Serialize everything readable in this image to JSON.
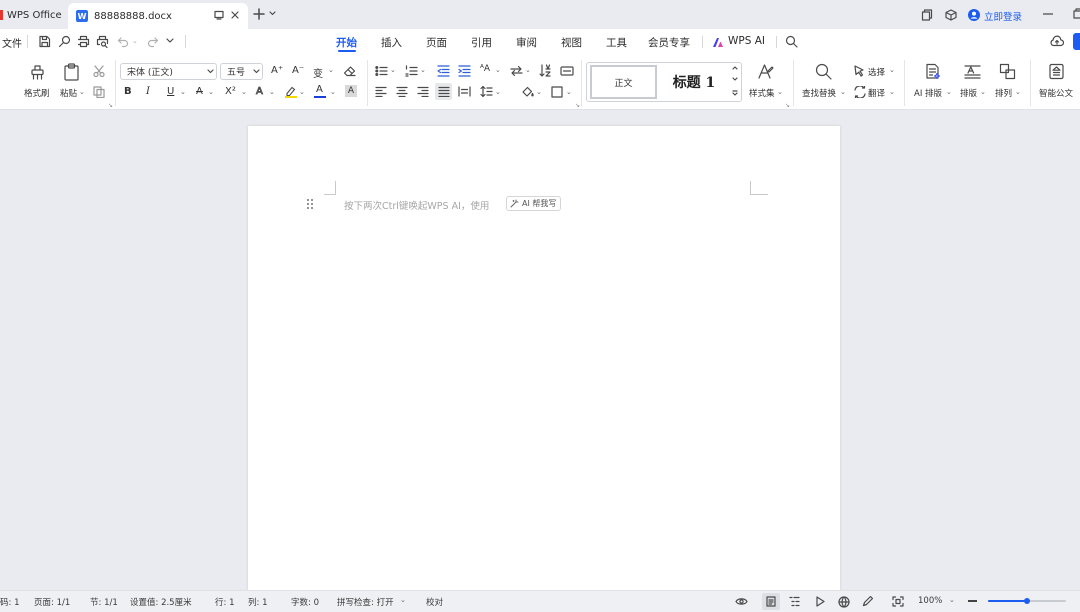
{
  "tabs": {
    "app": "WPS Office",
    "doc": "88888888.docx",
    "doc_icon": "W"
  },
  "window": {
    "login": "立即登录"
  },
  "menu": {
    "file": "文件",
    "items": [
      "开始",
      "插入",
      "页面",
      "引用",
      "审阅",
      "视图",
      "工具",
      "会员专享"
    ],
    "active": "开始",
    "wps_ai": "WPS AI"
  },
  "ribbon": {
    "format_painter": "格式刷",
    "paste": "粘贴",
    "font_name": "宋体 (正文)",
    "font_size": "五号",
    "style_normal": "正文",
    "style_heading": "标题 1",
    "style_set": "样式集",
    "find_replace": "查找替换",
    "select": "选择",
    "translate": "翻译",
    "ai_layout": "AI 排版",
    "layout": "排版",
    "arrange": "排列",
    "smart_doc": "智能公文",
    "bold": "B",
    "italic": "I",
    "underline": "U",
    "strike": "A",
    "superscript": "X²",
    "text_effect": "A",
    "font_color": "A",
    "char_shade": "A",
    "grow_font": "A⁺",
    "shrink_font": "A⁻",
    "pinyin": "变"
  },
  "document": {
    "hint": "按下两次Ctrl键唤起WPS AI，使用",
    "ai_chip": "AI 帮我写"
  },
  "status": {
    "page_no": "码: 1",
    "page": "页面: 1/1",
    "section": "节: 1/1",
    "position": "设置值: 2.5厘米",
    "row": "行: 1",
    "col": "列: 1",
    "words": "字数: 0",
    "spell": "拼写检查: 打开",
    "proof": "校对",
    "zoom": "100%",
    "zoom_level": 1.0
  },
  "colors": {
    "accent": "#1d5cf0",
    "highlight": "#f5d800",
    "font_color_bar": "#1a3fd8",
    "background": "#e9ebf0"
  }
}
